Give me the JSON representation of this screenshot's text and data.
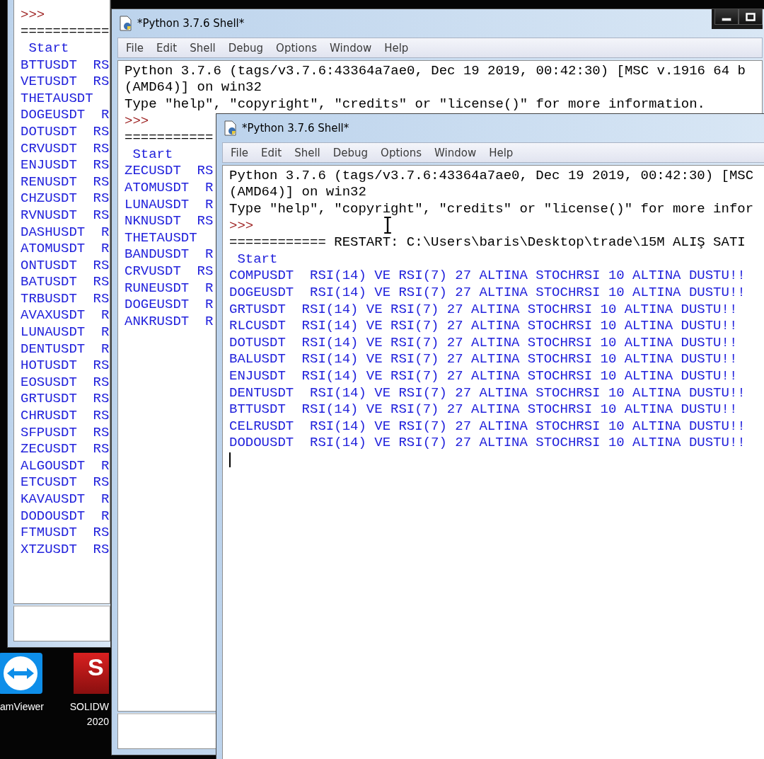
{
  "desktop": {
    "icons": [
      {
        "kind": "double-arrow",
        "labels": [
          "amViewer"
        ]
      },
      {
        "kind": "red-tile",
        "logo": "S",
        "labels": [
          "SOLIDW",
          "2020"
        ]
      }
    ]
  },
  "windows": [
    {
      "lines": [
        {
          "kind": "prompt",
          "text": ">>>"
        },
        {
          "kind": "text",
          "text": "==========="
        },
        {
          "kind": "output",
          "text": " Start"
        },
        {
          "kind": "output",
          "text": "BTTUSDT  RS"
        },
        {
          "kind": "output",
          "text": "VETUSDT  RS"
        },
        {
          "kind": "output",
          "text": "THETAUSDT"
        },
        {
          "kind": "output",
          "text": "DOGEUSDT  R"
        },
        {
          "kind": "output",
          "text": "DOTUSDT  RS"
        },
        {
          "kind": "output",
          "text": "CRVUSDT  RS"
        },
        {
          "kind": "output",
          "text": "ENJUSDT  RS"
        },
        {
          "kind": "output",
          "text": "RENUSDT  RS"
        },
        {
          "kind": "output",
          "text": "CHZUSDT  RS"
        },
        {
          "kind": "output",
          "text": "RVNUSDT  RS"
        },
        {
          "kind": "output",
          "text": "DASHUSDT  R"
        },
        {
          "kind": "output",
          "text": "ATOMUSDT  R"
        },
        {
          "kind": "output",
          "text": "ONTUSDT  RS"
        },
        {
          "kind": "output",
          "text": "BATUSDT  RS"
        },
        {
          "kind": "output",
          "text": "TRBUSDT  RS"
        },
        {
          "kind": "output",
          "text": "AVAXUSDT  R"
        },
        {
          "kind": "output",
          "text": "LUNAUSDT  R"
        },
        {
          "kind": "output",
          "text": "DENTUSDT  R"
        },
        {
          "kind": "output",
          "text": "HOTUSDT  RS"
        },
        {
          "kind": "output",
          "text": "EOSUSDT  RS"
        },
        {
          "kind": "output",
          "text": "GRTUSDT  RS"
        },
        {
          "kind": "output",
          "text": "CHRUSDT  RS"
        },
        {
          "kind": "output",
          "text": "SFPUSDT  RS"
        },
        {
          "kind": "output",
          "text": "ZECUSDT  RS"
        },
        {
          "kind": "output",
          "text": "ALGOUSDT  R"
        },
        {
          "kind": "output",
          "text": "ETCUSDT  RS"
        },
        {
          "kind": "output",
          "text": "KAVAUSDT  R"
        },
        {
          "kind": "output",
          "text": "DODOUSDT  R"
        },
        {
          "kind": "output",
          "text": "FTMUSDT  RS"
        },
        {
          "kind": "output",
          "text": "XTZUSDT  RS"
        }
      ]
    },
    {
      "title": "*Python 3.7.6 Shell*",
      "caption_buttons": [
        {
          "kind": "minimize"
        },
        {
          "kind": "maximize"
        }
      ],
      "menu": [
        "File",
        "Edit",
        "Shell",
        "Debug",
        "Options",
        "Window",
        "Help"
      ],
      "lines": [
        {
          "kind": "text",
          "text": "Python 3.7.6 (tags/v3.7.6:43364a7ae0, Dec 19 2019, 00:42:30) [MSC v.1916 64 b"
        },
        {
          "kind": "text",
          "text": "(AMD64)] on win32"
        },
        {
          "kind": "text",
          "text": "Type \"help\", \"copyright\", \"credits\" or \"license()\" for more information."
        },
        {
          "kind": "prompt",
          "text": ">>>"
        },
        {
          "kind": "text",
          "text": "==========="
        },
        {
          "kind": "output",
          "text": " Start"
        },
        {
          "kind": "output",
          "text": "ZECUSDT  RS"
        },
        {
          "kind": "output",
          "text": "ATOMUSDT  R"
        },
        {
          "kind": "output",
          "text": "LUNAUSDT  R"
        },
        {
          "kind": "output",
          "text": "NKNUSDT  RS"
        },
        {
          "kind": "output",
          "text": "THETAUSDT"
        },
        {
          "kind": "output",
          "text": "BANDUSDT  R"
        },
        {
          "kind": "output",
          "text": "CRVUSDT  RS"
        },
        {
          "kind": "output",
          "text": "RUNEUSDT  R"
        },
        {
          "kind": "output",
          "text": "DOGEUSDT  R"
        },
        {
          "kind": "output",
          "text": "ANKRUSDT  R"
        }
      ]
    },
    {
      "title": "*Python 3.7.6 Shell*",
      "menu": [
        "File",
        "Edit",
        "Shell",
        "Debug",
        "Options",
        "Window",
        "Help"
      ],
      "lines": [
        {
          "kind": "text",
          "text": "Python 3.7.6 (tags/v3.7.6:43364a7ae0, Dec 19 2019, 00:42:30) [MSC"
        },
        {
          "kind": "text",
          "text": "(AMD64)] on win32"
        },
        {
          "kind": "text",
          "text": "Type \"help\", \"copyright\", \"credits\" or \"license()\" for more infor"
        },
        {
          "kind": "prompt",
          "text": ">>>"
        },
        {
          "kind": "text",
          "text": "============ RESTART: C:\\Users\\baris\\Desktop\\trade\\15M ALIŞ SATI"
        },
        {
          "kind": "output",
          "text": " Start"
        },
        {
          "kind": "output",
          "text": "COMPUSDT  RSI(14) VE RSI(7) 27 ALTINA STOCHRSI 10 ALTINA DUSTU!!"
        },
        {
          "kind": "output",
          "text": "DOGEUSDT  RSI(14) VE RSI(7) 27 ALTINA STOCHRSI 10 ALTINA DUSTU!!"
        },
        {
          "kind": "output",
          "text": "GRTUSDT  RSI(14) VE RSI(7) 27 ALTINA STOCHRSI 10 ALTINA DUSTU!!"
        },
        {
          "kind": "output",
          "text": "RLCUSDT  RSI(14) VE RSI(7) 27 ALTINA STOCHRSI 10 ALTINA DUSTU!!"
        },
        {
          "kind": "output",
          "text": "DOTUSDT  RSI(14) VE RSI(7) 27 ALTINA STOCHRSI 10 ALTINA DUSTU!!"
        },
        {
          "kind": "output",
          "text": "BALUSDT  RSI(14) VE RSI(7) 27 ALTINA STOCHRSI 10 ALTINA DUSTU!!"
        },
        {
          "kind": "output",
          "text": "ENJUSDT  RSI(14) VE RSI(7) 27 ALTINA STOCHRSI 10 ALTINA DUSTU!!"
        },
        {
          "kind": "output",
          "text": "DENTUSDT  RSI(14) VE RSI(7) 27 ALTINA STOCHRSI 10 ALTINA DUSTU!!"
        },
        {
          "kind": "output",
          "text": "BTTUSDT  RSI(14) VE RSI(7) 27 ALTINA STOCHRSI 10 ALTINA DUSTU!!"
        },
        {
          "kind": "output",
          "text": "CELRUSDT  RSI(14) VE RSI(7) 27 ALTINA STOCHRSI 10 ALTINA DUSTU!!"
        },
        {
          "kind": "output",
          "text": "DODOUSDT  RSI(14) VE RSI(7) 27 ALTINA STOCHRSI 10 ALTINA DUSTU!!"
        }
      ]
    }
  ]
}
